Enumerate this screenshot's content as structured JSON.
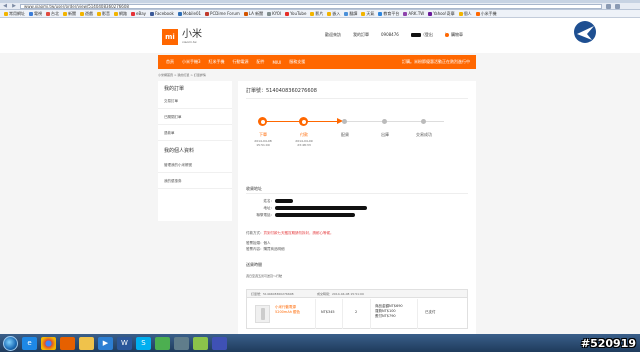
{
  "browser": {
    "url": "www.xiaomi.tw/user/order/view/5140408360276608",
    "bookmarks": [
      "常用網址",
      "電視",
      "台北",
      "新聞",
      "遊戲",
      "影音",
      "網路",
      "eBay",
      "Facebook",
      "Mobile01",
      "PCDime Forum",
      "LA 新聞",
      "KYOI",
      "YouTube",
      "影片",
      "嵌入",
      "翻譯",
      "天氣",
      "教育平台",
      "ARK.TW",
      "Yahoo!奇摩",
      "個人",
      "小米手機"
    ]
  },
  "header": {
    "logo": "mi",
    "brand_cn": "小米",
    "brand_en": "xiaomi.tw",
    "links": [
      "歡迎來訪",
      "我的訂單",
      "0908476",
      "購物車"
    ],
    "logout": "登出"
  },
  "nav": {
    "items": [
      "首頁",
      "小米手機3",
      "紅米手機",
      "行動電源",
      "配件",
      "MIUI",
      "服務支援"
    ],
    "promo": "訂購。米粉節優惠活動正在熱烈進行中"
  },
  "breadcrumb": "小米網首頁 > 我的訂單 > 訂單詳情",
  "sidebar": {
    "heading1": "我的訂單",
    "items1": [
      "交易訂單",
      "已關閉訂單",
      "退款單"
    ],
    "heading2": "我的個人資料",
    "items2": [
      "管理我的小米帳號",
      "我的優惠券"
    ]
  },
  "order": {
    "number_label": "訂單號：5140408360276608",
    "steps": [
      {
        "label": "下單",
        "time": "2014-04-08\n15:51:00",
        "done": true
      },
      {
        "label": "付款",
        "time": "2014-04-09\n23:48:33",
        "done": true
      },
      {
        "label": "配貨",
        "time": "",
        "done": false
      },
      {
        "label": "出庫",
        "time": "",
        "done": false
      },
      {
        "label": "交易成功",
        "time": "",
        "done": false
      }
    ],
    "receiver_heading": "收貨地址",
    "receiver_labels": [
      "姓名：",
      "地址：",
      "聯繫電話："
    ],
    "payment_label": "付款方式：",
    "payment_value": "貨到付款七天鑑賞期請勿拆封，請耐心等候。",
    "invoice_type": "發票抬頭：個人",
    "invoice_content": "發票內容：購買商品明細",
    "shipping_heading": "送貨時間",
    "shipping_value": "週日至週五皆可送貨～行駛",
    "table": {
      "order_no": "訂單號：5140408360276608",
      "placed": "成交時間：2014-04-08 15:51:00",
      "product": "小米行動電源 5200mAh 銀色",
      "price": "NT$345",
      "qty": "2",
      "totals": [
        "商品金額NT$690",
        "運費NT$100",
        "應付NT$790"
      ],
      "status": "已支付"
    }
  },
  "watermark": "#520919"
}
